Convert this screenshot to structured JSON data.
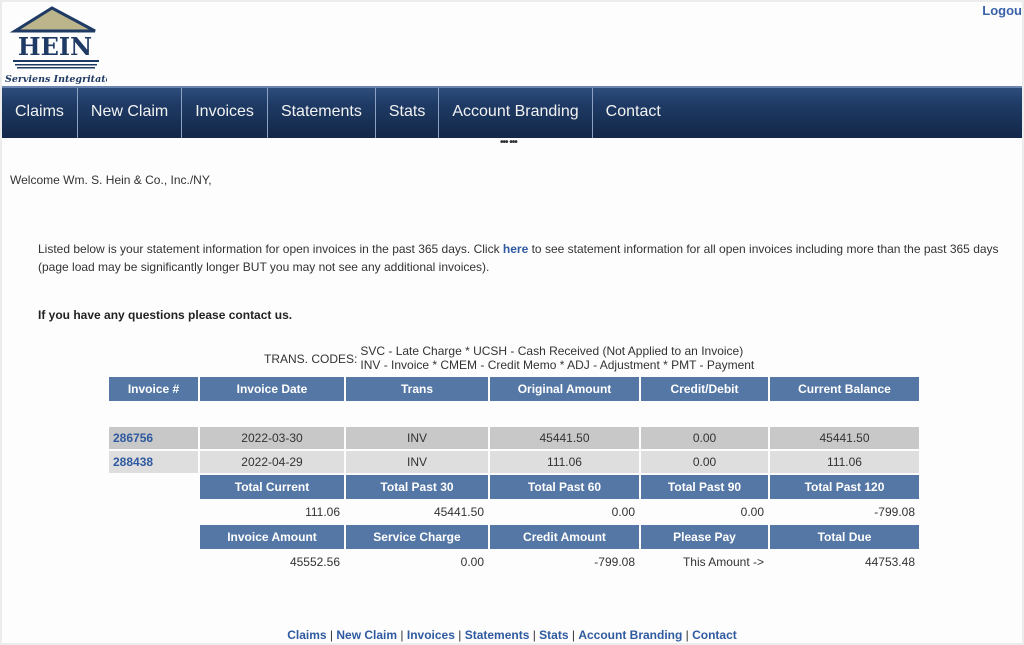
{
  "logo": {
    "name": "HEIN",
    "motto": "Serviens Integritate"
  },
  "header": {
    "logout_label": "Logou"
  },
  "nav": {
    "items": [
      {
        "label": "Claims"
      },
      {
        "label": "New Claim"
      },
      {
        "label": "Invoices"
      },
      {
        "label": "Statements"
      },
      {
        "label": "Stats"
      },
      {
        "label": "Account Branding"
      },
      {
        "label": "Contact"
      }
    ],
    "more_indicator": "••• •••"
  },
  "welcome": "Welcome Wm. S. Hein & Co., Inc./NY,",
  "info": {
    "before_link": "Listed below is your statement information for open invoices in the past 365 days. Click ",
    "link_label": "here",
    "after_link": " to see statement information for all open invoices including more than the past 365 days (page load may be significantly longer BUT you may not see any additional invoices)."
  },
  "questions": "If you have any questions please contact us.",
  "trans_codes": {
    "label": "TRANS. CODES:",
    "line1": "SVC - Late Charge * UCSH - Cash Received (Not Applied to an Invoice)",
    "line2": "INV - Invoice * CMEM - Credit Memo * ADJ - Adjustment * PMT - Payment"
  },
  "table": {
    "headers": [
      "Invoice #",
      "Invoice Date",
      "Trans",
      "Original Amount",
      "Credit/Debit",
      "Current Balance"
    ],
    "rows": [
      {
        "invoice": "286756",
        "date": "2022-03-30",
        "trans": "INV",
        "original": "45441.50",
        "credit_debit": "0.00",
        "balance": "45441.50"
      },
      {
        "invoice": "288438",
        "date": "2022-04-29",
        "trans": "INV",
        "original": "111.06",
        "credit_debit": "0.00",
        "balance": "111.06"
      }
    ],
    "aging_headers": [
      "Total Current",
      "Total Past 30",
      "Total Past 60",
      "Total Past 90",
      "Total Past 120"
    ],
    "aging_values": [
      "111.06",
      "45441.50",
      "0.00",
      "0.00",
      "-799.08"
    ],
    "summary_headers": [
      "Invoice Amount",
      "Service Charge",
      "Credit Amount",
      "Please Pay",
      "Total Due"
    ],
    "summary_values": [
      "45552.56",
      "0.00",
      "-799.08",
      "This Amount ->",
      "44753.48"
    ]
  },
  "footer": {
    "links": [
      "Claims",
      "New Claim",
      "Invoices",
      "Statements",
      "Stats",
      "Account Branding",
      "Contact"
    ],
    "separator": " | "
  },
  "colors": {
    "nav_dark": "#132748",
    "header_cell": "#5577a5",
    "row_odd": "#c8c8c8",
    "row_even": "#dedede",
    "link": "#2f5aa0"
  }
}
